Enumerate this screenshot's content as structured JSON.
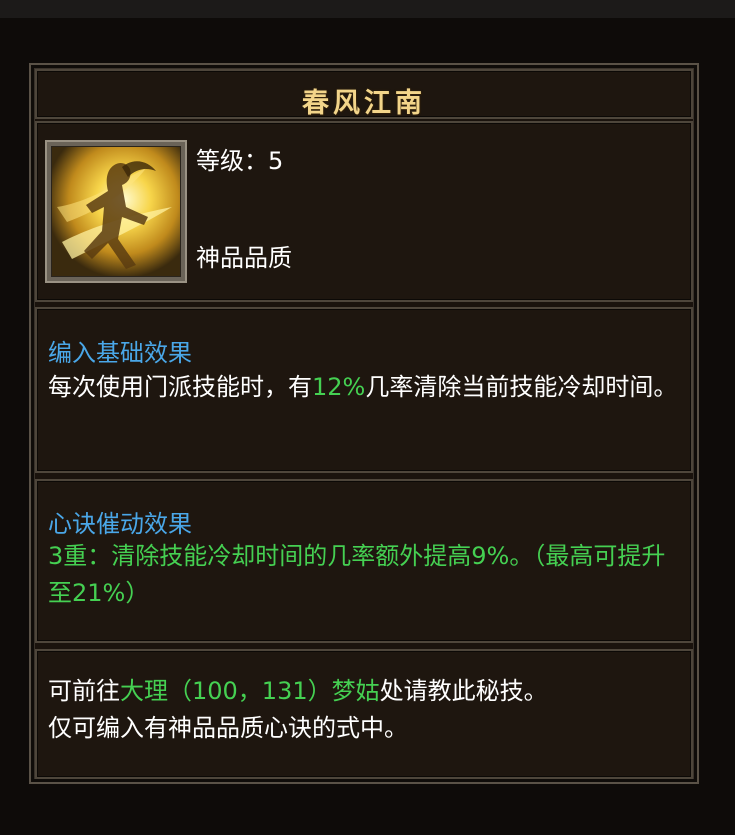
{
  "tooltip": {
    "title": "春风江南",
    "level": "等级：5",
    "quality": "神品品质",
    "icon": "running-figure-skill-icon",
    "colors": {
      "title": "#f3d58a",
      "section_title": "#4aa7e8",
      "highlight": "#45d052",
      "text": "#ffffff"
    },
    "base_effect": {
      "title": "编入基础效果",
      "text_before": "每次使用门派技能时，有",
      "chance": "12%",
      "text_after": "几率清除当前技能冷却时间。"
    },
    "urge_effect": {
      "title": "心诀催动效果",
      "text": "3重：清除技能冷却时间的几率额外提高9%。（最高可提升至21%）"
    },
    "info": {
      "prefix": "可前往",
      "location": "大理（100，131）梦姑",
      "suffix": "处请教此秘技。",
      "line2": "仅可编入有神品品质心诀的式中。"
    }
  }
}
